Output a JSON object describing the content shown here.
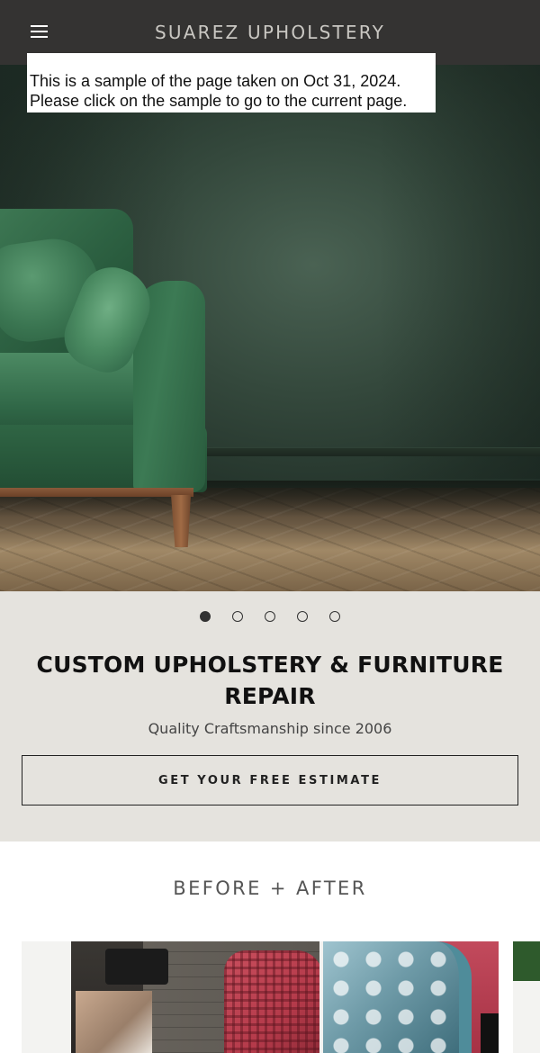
{
  "header": {
    "brand": "SUAREZ UPHOLSTERY",
    "menu_icon": "hamburger-menu-icon",
    "background": "#343332"
  },
  "archive_notice": {
    "line1": "This is a sample of the page taken on Oct 31, 2024.",
    "line2": "Please click on the sample to go to the current page."
  },
  "hero": {
    "image": "green velvet sofa in dark green room",
    "slides_total": 5,
    "active_slide": 1
  },
  "promo": {
    "title": "CUSTOM UPHOLSTERY & FURNITURE REPAIR",
    "subtitle": "Quality Craftsmanship since 2006",
    "cta_label": "GET YOUR FREE ESTIMATE",
    "background": "#e5e3de"
  },
  "gallery": {
    "title": "BEFORE + AFTER"
  }
}
